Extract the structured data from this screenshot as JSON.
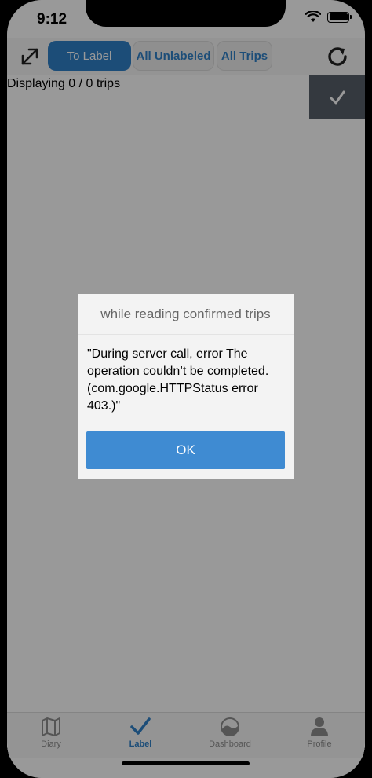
{
  "status_bar": {
    "time": "9:12",
    "battery_level": 1.0
  },
  "toolbar": {
    "tabs": [
      {
        "label": "To Label",
        "active": true
      },
      {
        "label": "All Unlabeled",
        "active": false
      },
      {
        "label": "All Trips",
        "active": false
      }
    ],
    "expand_icon": "expand-arrows-icon",
    "refresh_icon": "refresh-icon"
  },
  "content": {
    "displaying_text": "Displaying 0 / 0 trips"
  },
  "tab_bar": {
    "items": [
      {
        "label": "Diary",
        "icon": "map-icon",
        "active": false
      },
      {
        "label": "Label",
        "icon": "checkmark-icon",
        "active": true
      },
      {
        "label": "Dashboard",
        "icon": "dashboard-icon",
        "active": false
      },
      {
        "label": "Profile",
        "icon": "person-icon",
        "active": false
      }
    ]
  },
  "dialog": {
    "title": "while reading confirmed trips",
    "message": "\"During server call, error The operation couldn’t be completed. (com.google.HTTPStatus error 403.)\"",
    "ok_label": "OK"
  },
  "colors": {
    "accent": "#2f80c9",
    "ok_button": "#3f8bd2",
    "confirm_button": "#586069"
  }
}
